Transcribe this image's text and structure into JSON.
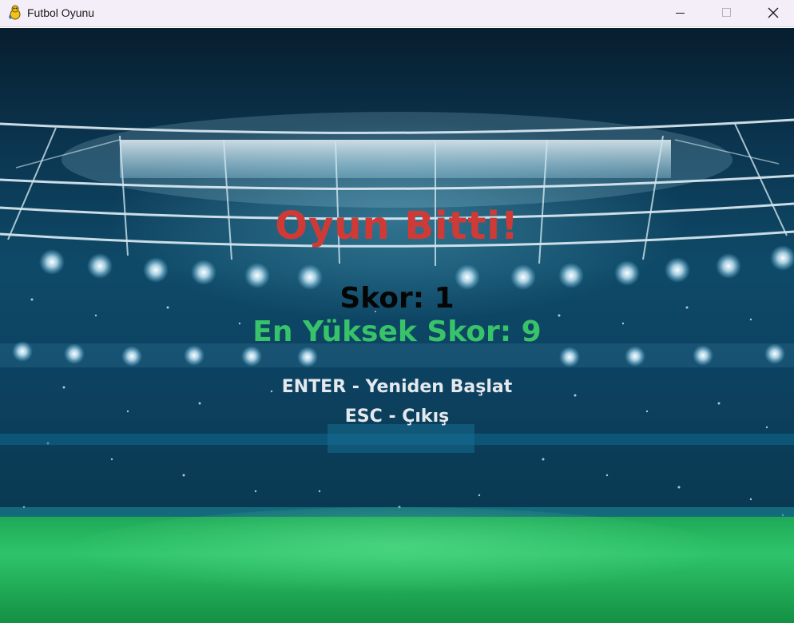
{
  "window": {
    "title": "Futbol Oyunu",
    "icon": "pygame-snake-icon",
    "controls": [
      "minimize-icon",
      "maximize-icon",
      "close-icon"
    ]
  },
  "game_over": {
    "title": "Oyun Bitti!",
    "score_line": "Skor: 1",
    "high_score_line": "En Yüksek Skor: 9",
    "restart_hint": "ENTER - Yeniden Başlat",
    "exit_hint": "ESC - Çıkış"
  },
  "colors": {
    "title": "#d03a36",
    "score": "#050505",
    "high_score": "#38c26a",
    "hints": "#e4e9ee",
    "pitch": "#22b45a"
  }
}
